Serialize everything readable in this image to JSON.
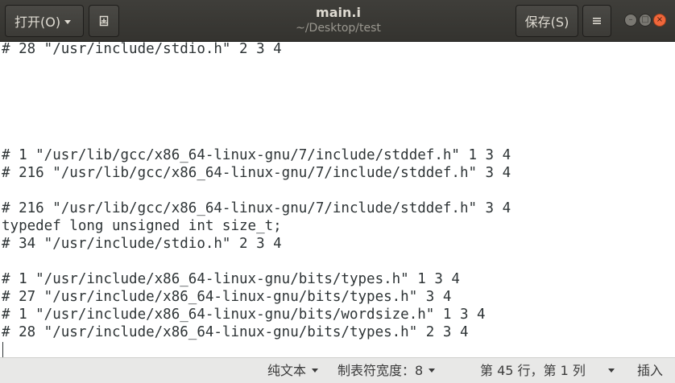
{
  "header": {
    "open_label": "打开(O)",
    "title": "main.i",
    "subtitle": "~/Desktop/test",
    "save_label": "保存(S)",
    "menu_icon": "hamburger-menu-icon",
    "newtab_icon": "new-document-icon"
  },
  "window_controls": {
    "minimize": "–",
    "maximize": "□",
    "close": "×"
  },
  "editor": {
    "lines": [
      "# 28 \"/usr/include/stdio.h\" 2 3 4",
      "",
      "",
      "",
      "",
      "",
      "# 1 \"/usr/lib/gcc/x86_64-linux-gnu/7/include/stddef.h\" 1 3 4",
      "# 216 \"/usr/lib/gcc/x86_64-linux-gnu/7/include/stddef.h\" 3 4",
      "",
      "# 216 \"/usr/lib/gcc/x86_64-linux-gnu/7/include/stddef.h\" 3 4",
      "typedef long unsigned int size_t;",
      "# 34 \"/usr/include/stdio.h\" 2 3 4",
      "",
      "# 1 \"/usr/include/x86_64-linux-gnu/bits/types.h\" 1 3 4",
      "# 27 \"/usr/include/x86_64-linux-gnu/bits/types.h\" 3 4",
      "# 1 \"/usr/include/x86_64-linux-gnu/bits/wordsize.h\" 1 3 4",
      "# 28 \"/usr/include/x86_64-linux-gnu/bits/types.h\" 2 3 4",
      ""
    ]
  },
  "statusbar": {
    "language": "纯文本",
    "tab_width": "制表符宽度：8",
    "position": "第 45 行，第 1 列",
    "mode": "插入"
  },
  "colors": {
    "headerbar": "#3c3b37",
    "close_button": "#f0673b",
    "statusbar": "#e8e8e7",
    "text": "#2e3436"
  }
}
